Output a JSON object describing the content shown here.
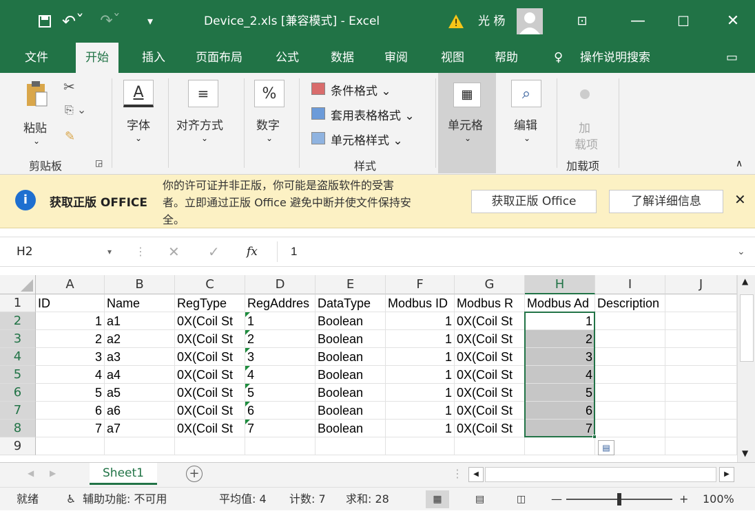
{
  "titlebar": {
    "title": "Device_2.xls  [兼容模式]  -  Excel",
    "user": "光 杨",
    "warning_icon": "warning-icon"
  },
  "tabs": [
    "文件",
    "开始",
    "插入",
    "页面布局",
    "公式",
    "数据",
    "审阅",
    "视图",
    "帮助"
  ],
  "active_tab": "开始",
  "tell_me": "操作说明搜索",
  "ribbon": {
    "paste": "粘贴",
    "clipboard_group": "剪贴板",
    "font": "字体",
    "alignment": "对齐方式",
    "number": "数字",
    "cond_format": "条件格式",
    "table_format": "套用表格格式",
    "cell_style": "单元格样式",
    "styles_group": "样式",
    "cells": "单元格",
    "editing": "编辑",
    "addins_btn_line1": "加",
    "addins_btn_line2": "载项",
    "addins_group": "加载项"
  },
  "notice": {
    "heading": "获取正版 OFFICE",
    "message_line1": "你的许可证并非正版，你可能是盗版软件的受害",
    "message_line2": "者。立即通过正版 Office 避免中断并使文件保持安",
    "message_line3": "全。",
    "btn_genuine": "获取正版 Office",
    "btn_learn": "了解详细信息"
  },
  "formula_bar": {
    "name_box": "H2",
    "fx": "fx",
    "value": "1"
  },
  "columns": [
    "A",
    "B",
    "C",
    "D",
    "E",
    "F",
    "G",
    "H",
    "I",
    "J"
  ],
  "rows": [
    "1",
    "2",
    "3",
    "4",
    "5",
    "6",
    "7",
    "8",
    "9"
  ],
  "header_row": [
    "ID",
    "Name",
    "RegType",
    "RegAddres",
    "DataType",
    "Modbus ID",
    "Modbus R",
    "Modbus Ad",
    "Description",
    ""
  ],
  "data_rows": [
    [
      "1",
      "a1",
      "0X(Coil St",
      "1",
      "Boolean",
      "1",
      "0X(Coil St",
      "1"
    ],
    [
      "2",
      "a2",
      "0X(Coil St",
      "2",
      "Boolean",
      "1",
      "0X(Coil St",
      "2"
    ],
    [
      "3",
      "a3",
      "0X(Coil St",
      "3",
      "Boolean",
      "1",
      "0X(Coil St",
      "3"
    ],
    [
      "4",
      "a4",
      "0X(Coil St",
      "4",
      "Boolean",
      "1",
      "0X(Coil St",
      "4"
    ],
    [
      "5",
      "a5",
      "0X(Coil St",
      "5",
      "Boolean",
      "1",
      "0X(Coil St",
      "5"
    ],
    [
      "6",
      "a6",
      "0X(Coil St",
      "6",
      "Boolean",
      "1",
      "0X(Coil St",
      "6"
    ],
    [
      "7",
      "a7",
      "0X(Coil St",
      "7",
      "Boolean",
      "1",
      "0X(Coil St",
      "7"
    ]
  ],
  "sheet_tab": "Sheet1",
  "status": {
    "ready": "就绪",
    "accessibility": "辅助功能: 不可用",
    "average": "平均值: 4",
    "count": "计数: 7",
    "sum": "求和: 28",
    "zoom": "100%"
  },
  "colors": {
    "accent": "#217346",
    "notice_bg": "#fcf1c4",
    "selection": "#c6c6c6"
  }
}
